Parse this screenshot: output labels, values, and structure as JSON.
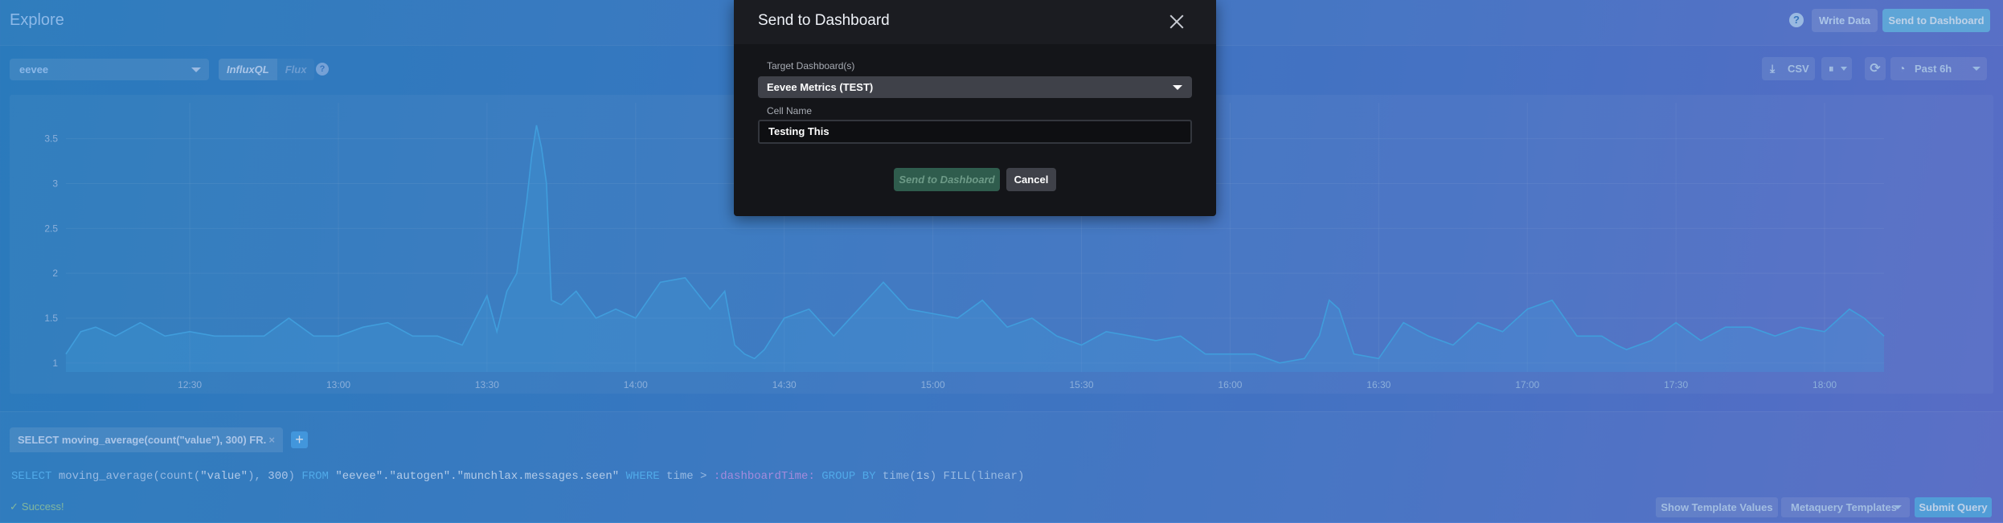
{
  "header": {
    "title": "Explore",
    "help_icon": "help-icon",
    "write_data_label": "Write Data",
    "send_to_dashboard_label": "Send to Dashboard"
  },
  "toolbar": {
    "database": "eevee",
    "lang_influxql": "InfluxQL",
    "lang_flux": "Flux",
    "csv_label": "CSV",
    "time_range": "Past 6h"
  },
  "colors": {
    "series": "#47b3f0",
    "accent": "#4aa9f0",
    "modal_bg": "#141519",
    "success": "#9ad3a0"
  },
  "chart_data": {
    "type": "area",
    "ylim": [
      0.9,
      3.9
    ],
    "yticks": [
      "1",
      "1.5",
      "2",
      "2.5",
      "3",
      "3.5"
    ],
    "xticks": [
      "12:30",
      "13:00",
      "13:30",
      "14:00",
      "14:30",
      "15:00",
      "15:30",
      "16:00",
      "16:30",
      "17:00",
      "17:30",
      "18:00"
    ],
    "x_minutes_start": 725,
    "x_minutes_end": 1092,
    "x": [
      725,
      728,
      731,
      735,
      740,
      745,
      750,
      755,
      760,
      765,
      770,
      775,
      780,
      785,
      790,
      795,
      800,
      805,
      810,
      812,
      814,
      816,
      818,
      819,
      820,
      821,
      822,
      823,
      825,
      828,
      832,
      836,
      840,
      845,
      850,
      855,
      858,
      860,
      862,
      864,
      866,
      870,
      875,
      880,
      885,
      890,
      895,
      900,
      905,
      910,
      915,
      920,
      925,
      930,
      935,
      940,
      945,
      950,
      955,
      960,
      965,
      970,
      975,
      978,
      980,
      982,
      985,
      990,
      995,
      1000,
      1005,
      1010,
      1015,
      1020,
      1025,
      1030,
      1035,
      1038,
      1040,
      1045,
      1050,
      1055,
      1060,
      1065,
      1070,
      1075,
      1080,
      1085,
      1088,
      1092
    ],
    "y": [
      1.1,
      1.35,
      1.4,
      1.3,
      1.45,
      1.3,
      1.35,
      1.3,
      1.3,
      1.3,
      1.5,
      1.3,
      1.3,
      1.4,
      1.45,
      1.3,
      1.3,
      1.2,
      1.75,
      1.35,
      1.8,
      2.0,
      2.8,
      3.3,
      3.65,
      3.4,
      3.0,
      1.7,
      1.65,
      1.8,
      1.5,
      1.6,
      1.5,
      1.9,
      1.95,
      1.6,
      1.8,
      1.2,
      1.1,
      1.05,
      1.15,
      1.5,
      1.6,
      1.3,
      1.6,
      1.9,
      1.6,
      1.55,
      1.5,
      1.7,
      1.4,
      1.5,
      1.3,
      1.2,
      1.35,
      1.3,
      1.25,
      1.3,
      1.1,
      1.1,
      1.1,
      1.0,
      1.05,
      1.3,
      1.7,
      1.6,
      1.1,
      1.05,
      1.45,
      1.3,
      1.2,
      1.45,
      1.35,
      1.6,
      1.7,
      1.3,
      1.3,
      1.2,
      1.15,
      1.25,
      1.45,
      1.25,
      1.4,
      1.4,
      1.3,
      1.4,
      1.35,
      1.6,
      1.5,
      1.3
    ]
  },
  "query": {
    "tab_label": "SELECT moving_average(count(\"value\"), 300) FR...",
    "tab_close": "×",
    "add_label": "+",
    "kw_select": "SELECT",
    "fn_text": "moving_average(count(",
    "str_value": "\"value\"",
    "fn_close": "), ",
    "num_300": "300",
    "paren_close": ") ",
    "kw_from": "FROM",
    "measurement": "\"eevee\".\"autogen\".\"munchlax.messages.seen\"",
    "kw_where": "WHERE",
    "time_cmp": "time > ",
    "dashboard_time": ":dashboardTime:",
    "kw_group": "GROUP BY",
    "group_fn": "time(",
    "group_num": "1s",
    "group_close": ") ",
    "fill_fn": "FILL(linear)",
    "status": "Success!",
    "status_icon": "✓",
    "show_template_values": "Show Template Values",
    "metaquery_templates": "Metaquery Templates",
    "submit_query": "Submit Query"
  },
  "modal": {
    "title": "Send to Dashboard",
    "target_label": "Target Dashboard(s)",
    "target_value": "Eevee Metrics (TEST)",
    "cell_name_label": "Cell Name",
    "cell_name_value": "Testing This",
    "send_label": "Send to Dashboard",
    "cancel_label": "Cancel"
  }
}
